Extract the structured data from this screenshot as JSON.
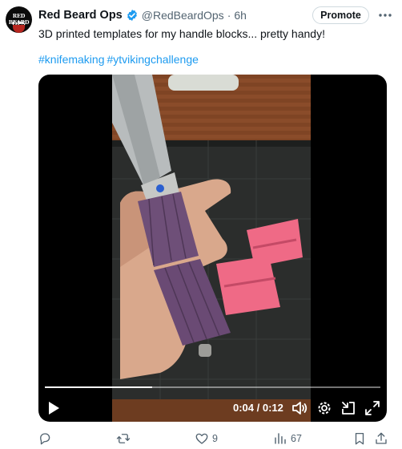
{
  "author": {
    "name": "Red Beard Ops",
    "handle": "@RedBeardOps",
    "separator": "·",
    "time": "6h",
    "avatar_text_top": "RED BEARD",
    "avatar_text_bottom": "OPS"
  },
  "promote_label": "Promote",
  "tweet_text": "3D printed templates for my handle blocks... pretty handy!",
  "hashtags": [
    "#knifemaking",
    "#ytvikingchallenge"
  ],
  "video": {
    "current_time": "0:04",
    "duration": "0:12",
    "time_separator": " / ",
    "progress_fraction": 0.32
  },
  "actions": {
    "reply_count": "",
    "repost_count": "",
    "like_count": "9",
    "views_count": "67"
  },
  "colors": {
    "accent": "#1d9bf0",
    "muted": "#536471",
    "verified": "#1d9bf0"
  }
}
